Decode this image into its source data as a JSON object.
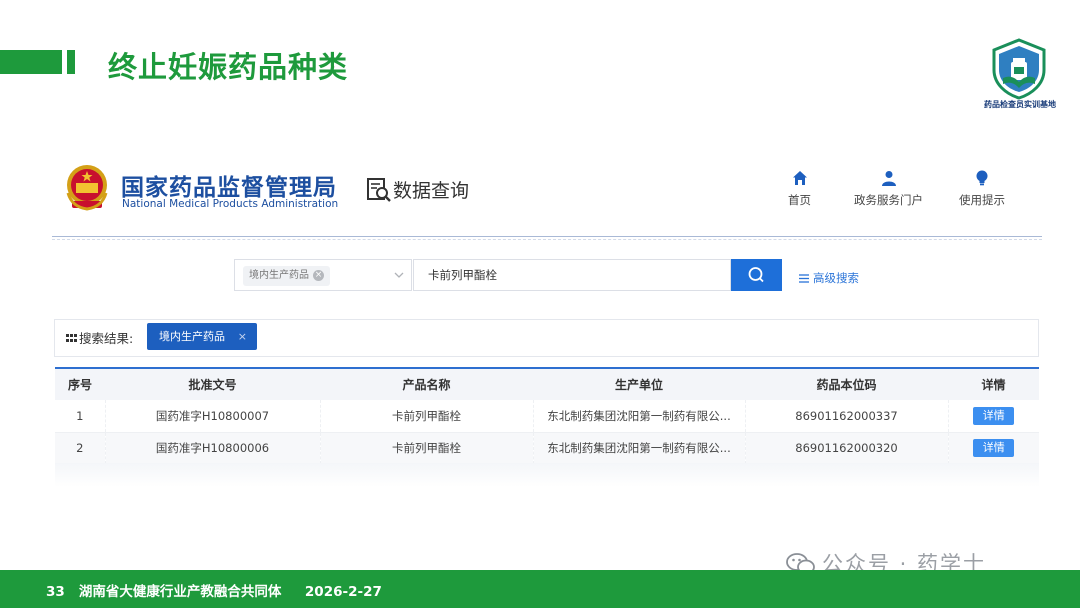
{
  "slide": {
    "title": "终止妊娠药品种类",
    "logo_caption": "药品检查员实训基地",
    "footer": {
      "page": "33",
      "org": "湖南省大健康行业产教融合共同体",
      "date": "2026-2-27"
    },
    "watermark": "公众号 · 药学士"
  },
  "site": {
    "name_cn": "国家药品监督管理局",
    "name_en": "National Medical Products Administration",
    "section": "数据查询",
    "nav": [
      {
        "label": "首页",
        "icon": "home-icon"
      },
      {
        "label": "政务服务门户",
        "icon": "user-icon"
      },
      {
        "label": "使用提示",
        "icon": "bulb-icon"
      }
    ]
  },
  "search": {
    "category_tag": "境内生产药品",
    "query": "卡前列甲酯栓",
    "advanced_label": "高级搜索"
  },
  "results": {
    "label": "搜索结果:",
    "filter_tag": "境内生产药品",
    "columns": [
      "序号",
      "批准文号",
      "产品名称",
      "生产单位",
      "药品本位码",
      "详情"
    ],
    "rows": [
      {
        "no": "1",
        "approval": "国药准字H10800007",
        "product": "卡前列甲酯栓",
        "maker": "东北制药集团沈阳第一制药有限公...",
        "code": "86901162000337",
        "detail": "详情"
      },
      {
        "no": "2",
        "approval": "国药准字H10800006",
        "product": "卡前列甲酯栓",
        "maker": "东北制药集团沈阳第一制药有限公...",
        "code": "86901162000320",
        "detail": "详情"
      }
    ]
  },
  "colors": {
    "slide_green": "#1e9a3c",
    "nmpa_blue": "#1d4fa0",
    "button_blue": "#1e6fd9",
    "detail_blue": "#3c8ff0"
  }
}
